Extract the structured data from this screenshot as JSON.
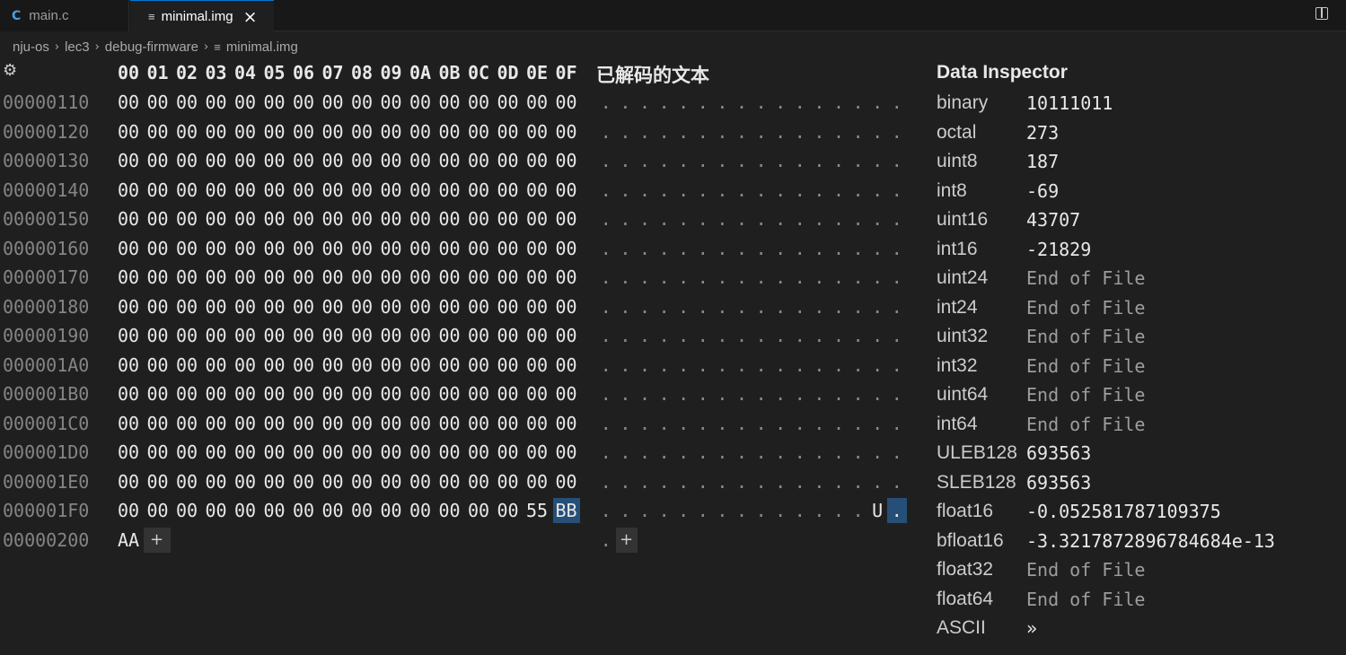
{
  "tabs": [
    {
      "icon": "C",
      "label": "main.c"
    },
    {
      "icon": "≡",
      "label": "minimal.img"
    }
  ],
  "breadcrumb": [
    "nju-os",
    "lec3",
    "debug-firmware",
    "minimal.img"
  ],
  "hex_view": {
    "column_headers": [
      "00",
      "01",
      "02",
      "03",
      "04",
      "05",
      "06",
      "07",
      "08",
      "09",
      "0A",
      "0B",
      "0C",
      "0D",
      "0E",
      "0F"
    ],
    "decoded_text_header": "已解码的文本",
    "rows": [
      {
        "offset": "00000110",
        "bytes": [
          "00",
          "00",
          "00",
          "00",
          "00",
          "00",
          "00",
          "00",
          "00",
          "00",
          "00",
          "00",
          "00",
          "00",
          "00",
          "00"
        ],
        "decoded": [
          ".",
          ".",
          ".",
          ".",
          ".",
          ".",
          ".",
          ".",
          ".",
          ".",
          ".",
          ".",
          ".",
          ".",
          ".",
          "."
        ]
      },
      {
        "offset": "00000120",
        "bytes": [
          "00",
          "00",
          "00",
          "00",
          "00",
          "00",
          "00",
          "00",
          "00",
          "00",
          "00",
          "00",
          "00",
          "00",
          "00",
          "00"
        ],
        "decoded": [
          ".",
          ".",
          ".",
          ".",
          ".",
          ".",
          ".",
          ".",
          ".",
          ".",
          ".",
          ".",
          ".",
          ".",
          ".",
          "."
        ]
      },
      {
        "offset": "00000130",
        "bytes": [
          "00",
          "00",
          "00",
          "00",
          "00",
          "00",
          "00",
          "00",
          "00",
          "00",
          "00",
          "00",
          "00",
          "00",
          "00",
          "00"
        ],
        "decoded": [
          ".",
          ".",
          ".",
          ".",
          ".",
          ".",
          ".",
          ".",
          ".",
          ".",
          ".",
          ".",
          ".",
          ".",
          ".",
          "."
        ]
      },
      {
        "offset": "00000140",
        "bytes": [
          "00",
          "00",
          "00",
          "00",
          "00",
          "00",
          "00",
          "00",
          "00",
          "00",
          "00",
          "00",
          "00",
          "00",
          "00",
          "00"
        ],
        "decoded": [
          ".",
          ".",
          ".",
          ".",
          ".",
          ".",
          ".",
          ".",
          ".",
          ".",
          ".",
          ".",
          ".",
          ".",
          ".",
          "."
        ]
      },
      {
        "offset": "00000150",
        "bytes": [
          "00",
          "00",
          "00",
          "00",
          "00",
          "00",
          "00",
          "00",
          "00",
          "00",
          "00",
          "00",
          "00",
          "00",
          "00",
          "00"
        ],
        "decoded": [
          ".",
          ".",
          ".",
          ".",
          ".",
          ".",
          ".",
          ".",
          ".",
          ".",
          ".",
          ".",
          ".",
          ".",
          ".",
          "."
        ]
      },
      {
        "offset": "00000160",
        "bytes": [
          "00",
          "00",
          "00",
          "00",
          "00",
          "00",
          "00",
          "00",
          "00",
          "00",
          "00",
          "00",
          "00",
          "00",
          "00",
          "00"
        ],
        "decoded": [
          ".",
          ".",
          ".",
          ".",
          ".",
          ".",
          ".",
          ".",
          ".",
          ".",
          ".",
          ".",
          ".",
          ".",
          ".",
          "."
        ]
      },
      {
        "offset": "00000170",
        "bytes": [
          "00",
          "00",
          "00",
          "00",
          "00",
          "00",
          "00",
          "00",
          "00",
          "00",
          "00",
          "00",
          "00",
          "00",
          "00",
          "00"
        ],
        "decoded": [
          ".",
          ".",
          ".",
          ".",
          ".",
          ".",
          ".",
          ".",
          ".",
          ".",
          ".",
          ".",
          ".",
          ".",
          ".",
          "."
        ]
      },
      {
        "offset": "00000180",
        "bytes": [
          "00",
          "00",
          "00",
          "00",
          "00",
          "00",
          "00",
          "00",
          "00",
          "00",
          "00",
          "00",
          "00",
          "00",
          "00",
          "00"
        ],
        "decoded": [
          ".",
          ".",
          ".",
          ".",
          ".",
          ".",
          ".",
          ".",
          ".",
          ".",
          ".",
          ".",
          ".",
          ".",
          ".",
          "."
        ]
      },
      {
        "offset": "00000190",
        "bytes": [
          "00",
          "00",
          "00",
          "00",
          "00",
          "00",
          "00",
          "00",
          "00",
          "00",
          "00",
          "00",
          "00",
          "00",
          "00",
          "00"
        ],
        "decoded": [
          ".",
          ".",
          ".",
          ".",
          ".",
          ".",
          ".",
          ".",
          ".",
          ".",
          ".",
          ".",
          ".",
          ".",
          ".",
          "."
        ]
      },
      {
        "offset": "000001A0",
        "bytes": [
          "00",
          "00",
          "00",
          "00",
          "00",
          "00",
          "00",
          "00",
          "00",
          "00",
          "00",
          "00",
          "00",
          "00",
          "00",
          "00"
        ],
        "decoded": [
          ".",
          ".",
          ".",
          ".",
          ".",
          ".",
          ".",
          ".",
          ".",
          ".",
          ".",
          ".",
          ".",
          ".",
          ".",
          "."
        ]
      },
      {
        "offset": "000001B0",
        "bytes": [
          "00",
          "00",
          "00",
          "00",
          "00",
          "00",
          "00",
          "00",
          "00",
          "00",
          "00",
          "00",
          "00",
          "00",
          "00",
          "00"
        ],
        "decoded": [
          ".",
          ".",
          ".",
          ".",
          ".",
          ".",
          ".",
          ".",
          ".",
          ".",
          ".",
          ".",
          ".",
          ".",
          ".",
          "."
        ]
      },
      {
        "offset": "000001C0",
        "bytes": [
          "00",
          "00",
          "00",
          "00",
          "00",
          "00",
          "00",
          "00",
          "00",
          "00",
          "00",
          "00",
          "00",
          "00",
          "00",
          "00"
        ],
        "decoded": [
          ".",
          ".",
          ".",
          ".",
          ".",
          ".",
          ".",
          ".",
          ".",
          ".",
          ".",
          ".",
          ".",
          ".",
          ".",
          "."
        ]
      },
      {
        "offset": "000001D0",
        "bytes": [
          "00",
          "00",
          "00",
          "00",
          "00",
          "00",
          "00",
          "00",
          "00",
          "00",
          "00",
          "00",
          "00",
          "00",
          "00",
          "00"
        ],
        "decoded": [
          ".",
          ".",
          ".",
          ".",
          ".",
          ".",
          ".",
          ".",
          ".",
          ".",
          ".",
          ".",
          ".",
          ".",
          ".",
          "."
        ]
      },
      {
        "offset": "000001E0",
        "bytes": [
          "00",
          "00",
          "00",
          "00",
          "00",
          "00",
          "00",
          "00",
          "00",
          "00",
          "00",
          "00",
          "00",
          "00",
          "00",
          "00"
        ],
        "decoded": [
          ".",
          ".",
          ".",
          ".",
          ".",
          ".",
          ".",
          ".",
          ".",
          ".",
          ".",
          ".",
          ".",
          ".",
          ".",
          "."
        ]
      },
      {
        "offset": "000001F0",
        "bytes": [
          "00",
          "00",
          "00",
          "00",
          "00",
          "00",
          "00",
          "00",
          "00",
          "00",
          "00",
          "00",
          "00",
          "00",
          "55",
          "BB"
        ],
        "decoded": [
          ".",
          ".",
          ".",
          ".",
          ".",
          ".",
          ".",
          ".",
          ".",
          ".",
          ".",
          ".",
          ".",
          ".",
          "U",
          "."
        ]
      },
      {
        "offset": "00000200",
        "bytes": [
          "AA"
        ],
        "decoded": [
          "."
        ]
      }
    ],
    "add_byte_label": "+"
  },
  "data_inspector": {
    "title": "Data Inspector",
    "rows": [
      {
        "label": "binary",
        "value": "10111011"
      },
      {
        "label": "octal",
        "value": "273"
      },
      {
        "label": "uint8",
        "value": "187"
      },
      {
        "label": "int8",
        "value": "-69"
      },
      {
        "label": "uint16",
        "value": "43707"
      },
      {
        "label": "int16",
        "value": "-21829"
      },
      {
        "label": "uint24",
        "value": "End of File"
      },
      {
        "label": "int24",
        "value": "End of File"
      },
      {
        "label": "uint32",
        "value": "End of File"
      },
      {
        "label": "int32",
        "value": "End of File"
      },
      {
        "label": "uint64",
        "value": "End of File"
      },
      {
        "label": "int64",
        "value": "End of File"
      },
      {
        "label": "ULEB128",
        "value": "693563"
      },
      {
        "label": "SLEB128",
        "value": "693563"
      },
      {
        "label": "float16",
        "value": "-0.052581787109375"
      },
      {
        "label": "bfloat16",
        "value": "-3.3217872896784684e-13"
      },
      {
        "label": "float32",
        "value": "End of File"
      },
      {
        "label": "float64",
        "value": "End of File"
      },
      {
        "label": "ASCII",
        "value": "»"
      }
    ]
  }
}
